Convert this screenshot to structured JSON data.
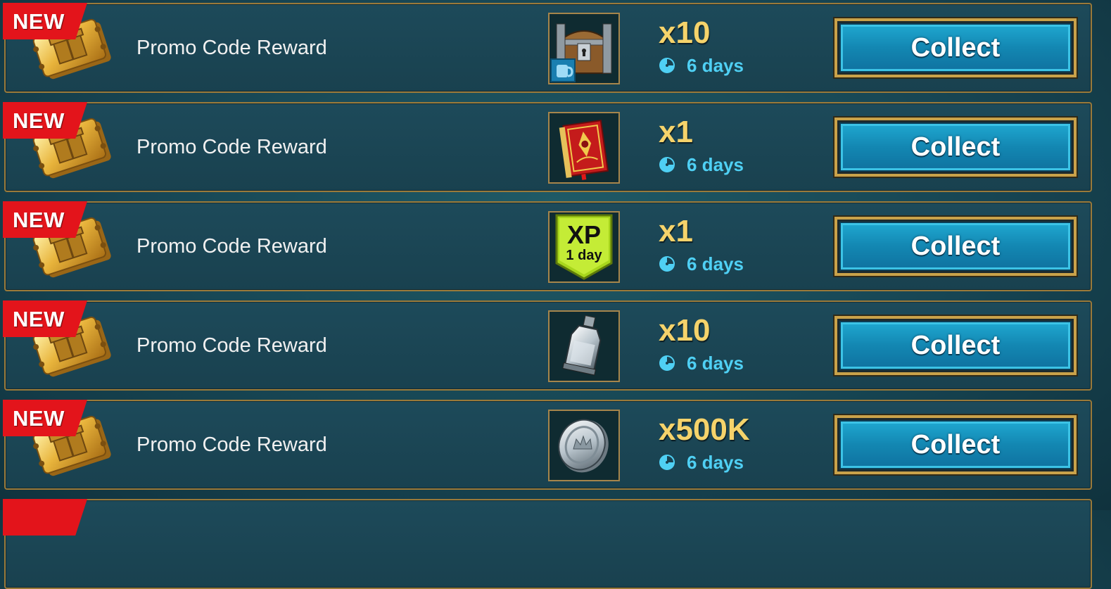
{
  "rewards": [
    {
      "badge": "NEW",
      "title": "Promo Code Reward",
      "item_icon": "chest-icon",
      "quantity": "x10",
      "time_left": "6 days",
      "button": "Collect"
    },
    {
      "badge": "NEW",
      "title": "Promo Code Reward",
      "item_icon": "tome-icon",
      "quantity": "x1",
      "time_left": "6 days",
      "button": "Collect"
    },
    {
      "badge": "NEW",
      "title": "Promo Code Reward",
      "item_icon": "xp-boost-icon",
      "item_label_top": "XP",
      "item_label_bottom": "1 day",
      "quantity": "x1",
      "time_left": "6 days",
      "button": "Collect"
    },
    {
      "badge": "NEW",
      "title": "Promo Code Reward",
      "item_icon": "potion-icon",
      "quantity": "x10",
      "time_left": "6 days",
      "button": "Collect"
    },
    {
      "badge": "NEW",
      "title": "Promo Code Reward",
      "item_icon": "silver-coin-icon",
      "quantity": "x500K",
      "time_left": "6 days",
      "button": "Collect"
    }
  ],
  "colors": {
    "new_badge": "#e3141b",
    "quantity": "#f5d36b",
    "timer": "#4fd0f4",
    "button": "#1387b2",
    "frame_gold": "#c9a24a"
  }
}
